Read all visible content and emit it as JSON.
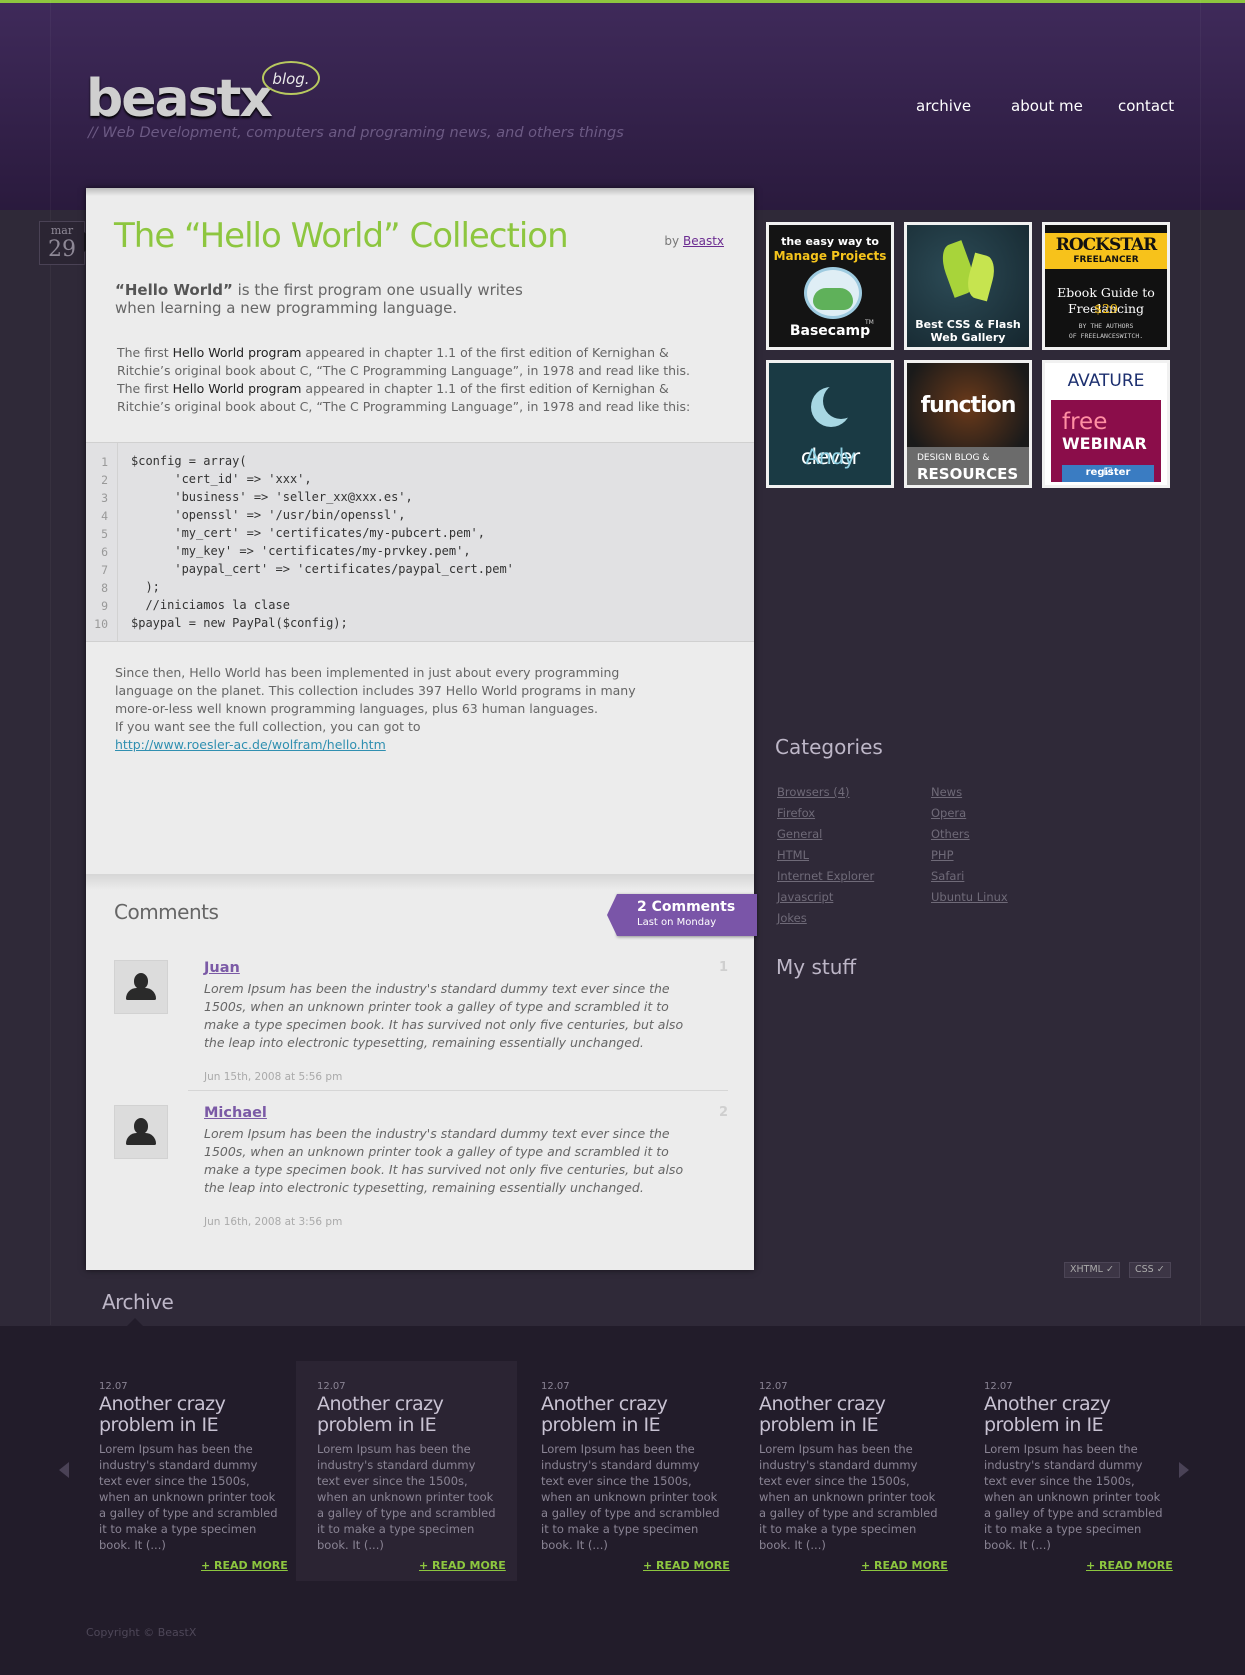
{
  "header": {
    "logo": "beastx",
    "logo_bubble": "blog.",
    "tagline": "// Web Development, computers and programing news, and others things",
    "nav": [
      "archive",
      "about me",
      "contact"
    ]
  },
  "post": {
    "date_month": "mar",
    "date_day": "29",
    "title": "The “Hello World” Collection",
    "by_label": "by",
    "author": "Beastx",
    "intro_bold": "“Hello World”",
    "intro_rest": " is the first program one usually writes when learning a new programming language.",
    "body1": {
      "p1": "The first ",
      "hl1": "Hello World program",
      "p2": " appeared in chapter 1.1 of the first edition of Kernighan & Ritchie’s original book about C, “The C Programming Language”, in 1978 and read like this. The first ",
      "hl2": "Hello World program",
      "p3": " appeared in chapter 1.1 of the first edition of Kernighan & Ritchie’s original book about C, “The C Programming Language”, in 1978 and read like this:"
    },
    "code": [
      {
        "n": "1",
        "text": "$config = array("
      },
      {
        "n": "2",
        "text": "      'cert_id' => 'xxx',"
      },
      {
        "n": "3",
        "text": "      'business' => 'seller_xx@xxx.es',"
      },
      {
        "n": "4",
        "text": "      'openssl' => '/usr/bin/openssl',"
      },
      {
        "n": "5",
        "text": "      'my_cert' => 'certificates/my-pubcert.pem',"
      },
      {
        "n": "6",
        "text": "      'my_key' => 'certificates/my-prvkey.pem',"
      },
      {
        "n": "7",
        "text": "      'paypal_cert' => 'certificates/paypal_cert.pem'"
      },
      {
        "n": "8",
        "text": "  );"
      },
      {
        "n": "9",
        "text": "  //iniciamos la clase"
      },
      {
        "n": "10",
        "text": "$paypal = new PayPal($config);"
      }
    ],
    "body2": "Since then, Hello World has been implemented in just about every programming language on the planet. This collection includes 397 Hello World programs in many more-or-less well known programming languages, plus 63 human languages.",
    "body2_line2": "If you want see the full collection, you can got to",
    "body2_link": "http://www.roesler-ac.de/wolfram/hello.htm"
  },
  "comments": {
    "heading": "Comments",
    "count_label": "2 Comments",
    "last_label": "Last on Monday",
    "items": [
      {
        "name": "Juan",
        "num": "1",
        "text": "Lorem Ipsum has been the industry's standard dummy text ever since the 1500s, when an unknown printer took a galley of type and scrambled it to make a type specimen book. It has survived not only five centuries, but also the leap into electronic typesetting, remaining essentially unchanged.",
        "date": "Jun 15th, 2008 at 5:56 pm"
      },
      {
        "name": "Michael",
        "num": "2",
        "text": "Lorem Ipsum has been the industry's standard dummy text ever since the 1500s, when an unknown printer took a galley of type and scrambled it to make a type specimen book. It has survived not only five centuries, but also the leap into electronic typesetting, remaining essentially unchanged.",
        "date": "Jun 16th, 2008 at 3:56 pm"
      }
    ]
  },
  "sidebar": {
    "ads": {
      "basecamp": {
        "line1": "the easy way to",
        "line2": "Manage Projects",
        "line3": "Basecamp",
        "tm": "TM"
      },
      "css_gallery": {
        "line1": "Best CSS & Flash",
        "line2": "Web Gallery"
      },
      "rockstar": {
        "line1": "ROCKSTAR",
        "line2": "FREELANCER",
        "line3": "Ebook Guide to",
        "line4": "Freelancing",
        "price": "$29",
        "line5": "BY THE AUTHORS",
        "line6": "OF FREELANCESWITCH."
      },
      "clever_andy": {
        "line1": "clever",
        "line2": "Andy"
      },
      "function": {
        "line1": "function",
        "line2": "DESIGN BLOG &",
        "line3": "RESOURCES"
      },
      "avature": {
        "line1": "AVATURE",
        "line2": "free",
        "line3": "WEBINAR",
        "line4": "register"
      }
    },
    "categories_heading": "Categories",
    "categories_col1": [
      "Browsers (4)",
      "Firefox",
      "General",
      "HTML",
      "Internet Explorer",
      "Javascript",
      "Jokes"
    ],
    "categories_col2": [
      "News",
      "Opera",
      "Others",
      "PHP",
      "Safari",
      "Ubuntu Linux"
    ],
    "mystuff_heading": "My stuff",
    "badges": [
      "XHTML ✓",
      "CSS ✓"
    ]
  },
  "archive": {
    "heading": "Archive",
    "cards": [
      {
        "date": "12.07",
        "title": "Another crazy problem in IE",
        "text": "Lorem Ipsum has been the industry's standard dummy text ever since the 1500s, when an unknown printer took a galley of type and scrambled it to make a type specimen book. It (...)",
        "more": "+ READ MORE"
      },
      {
        "date": "12.07",
        "title": "Another crazy problem in IE",
        "text": "Lorem Ipsum has been the industry's standard dummy text ever since the 1500s, when an unknown printer took a galley of type and scrambled it to make a type specimen book. It (...)",
        "more": "+ READ MORE"
      },
      {
        "date": "12.07",
        "title": "Another crazy problem in IE",
        "text": "Lorem Ipsum has been the industry's standard dummy text ever since the 1500s, when an unknown printer took a galley of type and scrambled it to make a type specimen book. It (...)",
        "more": "+ READ MORE"
      },
      {
        "date": "12.07",
        "title": "Another crazy problem in IE",
        "text": "Lorem Ipsum has been the industry's standard dummy text ever since the 1500s, when an unknown printer took a galley of type and scrambled it to make a type specimen book. It (...)",
        "more": "+ READ MORE"
      },
      {
        "date": "12.07",
        "title": "Another crazy problem in IE",
        "text": "Lorem Ipsum has been the industry's standard dummy text ever since the 1500s, when an unknown printer took a galley of type and scrambled it to make a type specimen book. It (...)",
        "more": "+ READ MORE"
      }
    ]
  },
  "footer": {
    "copyright": "Copyright © BeastX"
  },
  "colors": {
    "accent_green": "#8dc63f",
    "brand_purple": "#3f2a5a",
    "ribbon_purple": "#7a55a8",
    "link_blue": "#2f8fb0"
  }
}
